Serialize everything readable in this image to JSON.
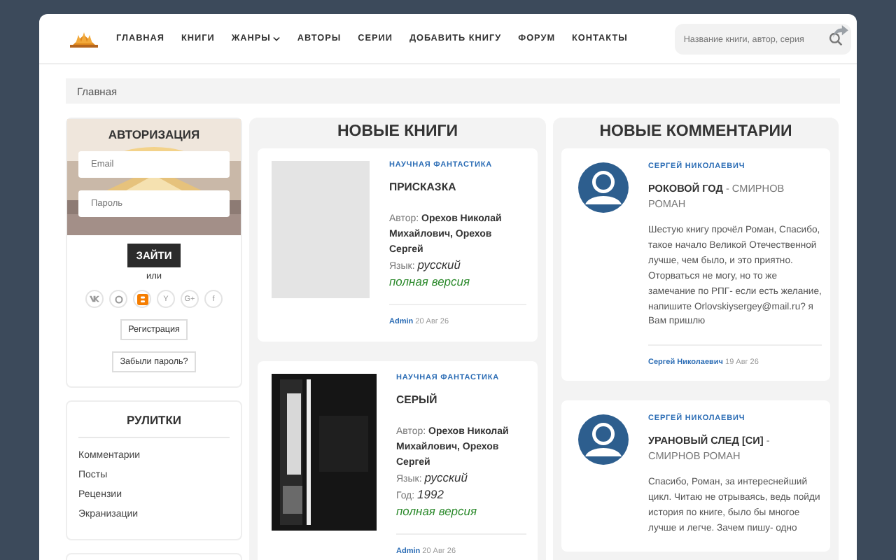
{
  "nav": {
    "items": [
      {
        "label": "ГЛАВНАЯ",
        "dropdown": false
      },
      {
        "label": "КНИГИ",
        "dropdown": false
      },
      {
        "label": "ЖАНРЫ",
        "dropdown": true
      },
      {
        "label": "АВТОРЫ",
        "dropdown": false
      },
      {
        "label": "СЕРИИ",
        "dropdown": false
      },
      {
        "label": "ДОБАВИТЬ КНИГУ",
        "dropdown": false
      },
      {
        "label": "ФОРУМ",
        "dropdown": false
      },
      {
        "label": "КОНТАКТЫ",
        "dropdown": false
      }
    ],
    "search": {
      "placeholder": "Название книги, автор, серия"
    }
  },
  "breadcrumb": "Главная",
  "login": {
    "title": "АВТОРИЗАЦИЯ",
    "email_placeholder": "Email",
    "password_placeholder": "Пароль",
    "submit": "ЗАЙТИ",
    "or": "или",
    "socials": [
      {
        "kind": "vk"
      },
      {
        "kind": "ok"
      },
      {
        "kind": "blogger"
      },
      {
        "kind": "letter",
        "label": "Y"
      },
      {
        "kind": "letter",
        "label": "G+"
      },
      {
        "kind": "letter",
        "label": "f"
      }
    ],
    "register": "Регистрация",
    "forgot": "Забыли пароль?"
  },
  "rubrics": {
    "title": "РУЛИТКИ",
    "items": [
      "Комментарии",
      "Посты",
      "Рецензии",
      "Экранизации"
    ]
  },
  "new_books": {
    "title": "НОВЫЕ КНИГИ",
    "books": [
      {
        "genre": "НАУЧНАЯ ФАНТАСТИКА",
        "title": "ПРИСКАЗКА",
        "author_label": "Автор:",
        "author": "Орехов Николай Михайлович, Орехов Сергей",
        "language_label": "Язык:",
        "language": "русский",
        "status": "полная версия",
        "user": "Admin",
        "date": "20 Авг 26"
      },
      {
        "genre": "НАУЧНАЯ ФАНТАСТИКА",
        "title": "СЕРЫЙ",
        "author_label": "Автор:",
        "author": "Орехов Николай Михайлович, Орехов Сергей",
        "language_label": "Язык:",
        "language": "русский",
        "year_label": "Год:",
        "year": "1992",
        "status": "полная версия",
        "user": "Admin",
        "date": "20 Авг 26"
      }
    ]
  },
  "new_comments": {
    "title": "НОВЫЕ КОММЕНТАРИИ",
    "comments": [
      {
        "author": "СЕРГЕЙ НИКОЛАЕВИЧ",
        "book": "РОКОВОЙ ГОД",
        "book_author": "- СМИРНОВ РОМАН",
        "text": "Шестую книгу прочёл Роман, Спасибо, такое начало Великой Отечественной лучше, чем было, и это приятно. Оторваться не могу, но то же замечание по РПГ- если есть желание, напишите Orlovskiysergey@mail.ru? я Вам пришлю",
        "user": "Сергей Николаевич",
        "date": "19 Авг 26"
      },
      {
        "author": "СЕРГЕЙ НИКОЛАЕВИЧ",
        "book": "УРАНОВЫЙ СЛЕД [СИ]",
        "book_author": "- СМИРНОВ РОМАН",
        "text": "Спасибо, Роман, за интереснейший цикл. Читаю не отрываясь, ведь пойди история по книге, было бы многое лучше и легче. Зачем пишу- одно"
      }
    ]
  }
}
